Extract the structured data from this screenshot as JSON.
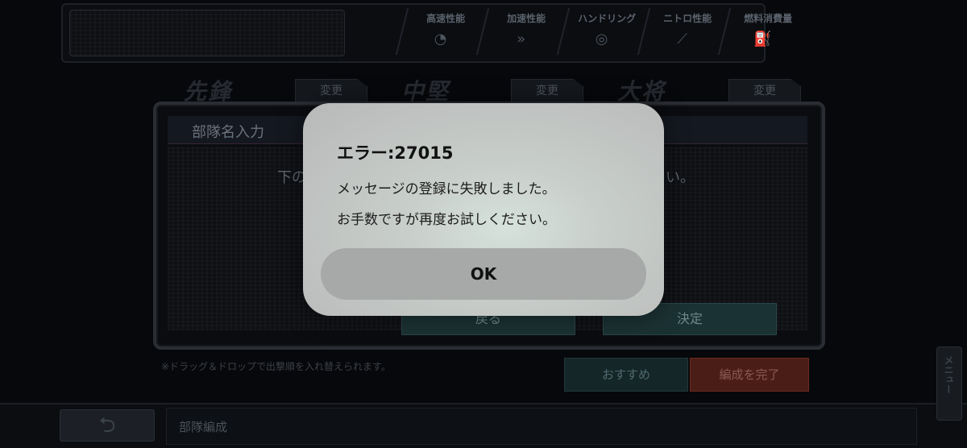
{
  "top_stats": [
    {
      "label": "高速性能",
      "icon": "speedometer-icon"
    },
    {
      "label": "加速性能",
      "icon": "acceleration-icon"
    },
    {
      "label": "ハンドリング",
      "icon": "steering-wheel-icon"
    },
    {
      "label": "ニトロ性能",
      "icon": "nitro-icon"
    },
    {
      "label": "燃料消費量",
      "icon": "fuel-pump-icon"
    }
  ],
  "slots": [
    {
      "tag": "先鋒",
      "change_label": "変更"
    },
    {
      "tag": "中堅",
      "change_label": "変更"
    },
    {
      "tag": "大将",
      "change_label": "変更"
    }
  ],
  "unit_dialog": {
    "title": "部隊名入力",
    "instruction_start": "下の",
    "instruction_end": "い。",
    "cancel_label": "戻る",
    "confirm_label": "決定"
  },
  "drag_hint": "※ドラッグ＆ドロップで出撃順を入れ替えられます。",
  "recommend_label": "おすすめ",
  "complete_label": "編成を完了",
  "footer_label": "部隊編成",
  "menu_label": "メニュー",
  "alert": {
    "title": "エラー:27015",
    "message_line1": "メッセージの登録に失敗しました。",
    "message_line2": "お手数ですが再度お試しください。",
    "ok_label": "OK"
  },
  "colors": {
    "background": "#07080b",
    "accent_red": "#8a2e20",
    "accent_teal": "#1b3234"
  }
}
